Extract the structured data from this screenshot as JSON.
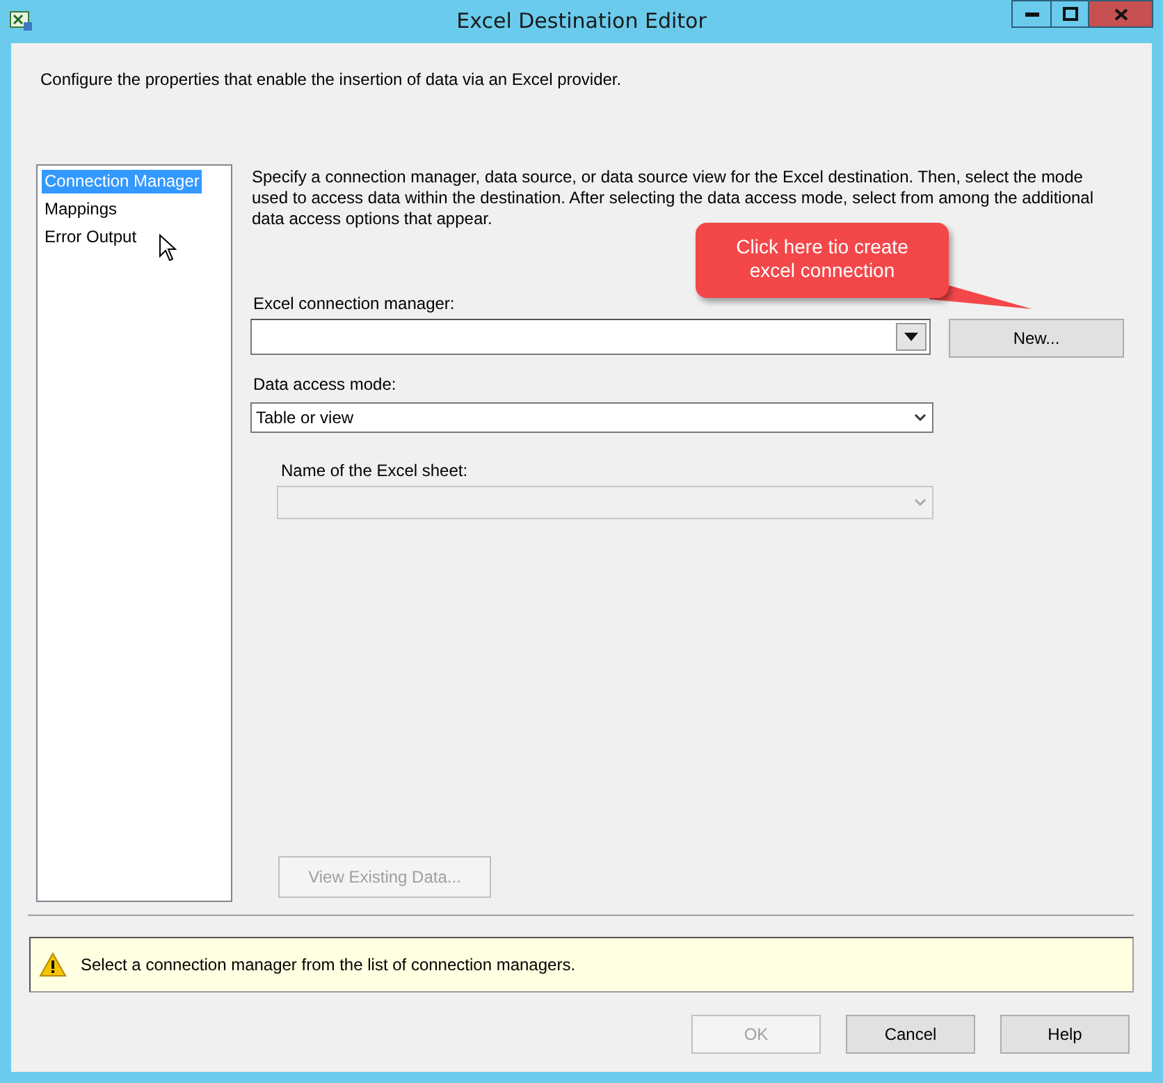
{
  "window": {
    "title": "Excel Destination Editor"
  },
  "description": "Configure the properties that enable the insertion of data via an Excel provider.",
  "sidebar": {
    "items": [
      {
        "label": "Connection Manager",
        "selected": true
      },
      {
        "label": "Mappings",
        "selected": false
      },
      {
        "label": "Error Output",
        "selected": false
      }
    ]
  },
  "instructions": "Specify a connection manager, data source, or data source view for the Excel destination. Then, select the mode used to access data within the destination. After selecting the data access mode, select from among the additional data access options that appear.",
  "callout": {
    "text": "Click here tio create excel connection"
  },
  "connection_manager": {
    "label": "Excel connection manager:"
  },
  "new_button": {
    "label": "New..."
  },
  "access_mode": {
    "label": "Data access mode:",
    "value": "Table or view"
  },
  "sheet": {
    "label": "Name of the Excel sheet:",
    "disabled": true
  },
  "view_button": {
    "label": "View Existing Data...",
    "disabled": true
  },
  "message": {
    "kind": "warning",
    "text": "Select a connection manager from the list of connection managers."
  },
  "buttons": [
    {
      "label": "OK",
      "disabled": true
    },
    {
      "label": "Cancel",
      "disabled": false
    },
    {
      "label": "Help",
      "disabled": false
    }
  ]
}
